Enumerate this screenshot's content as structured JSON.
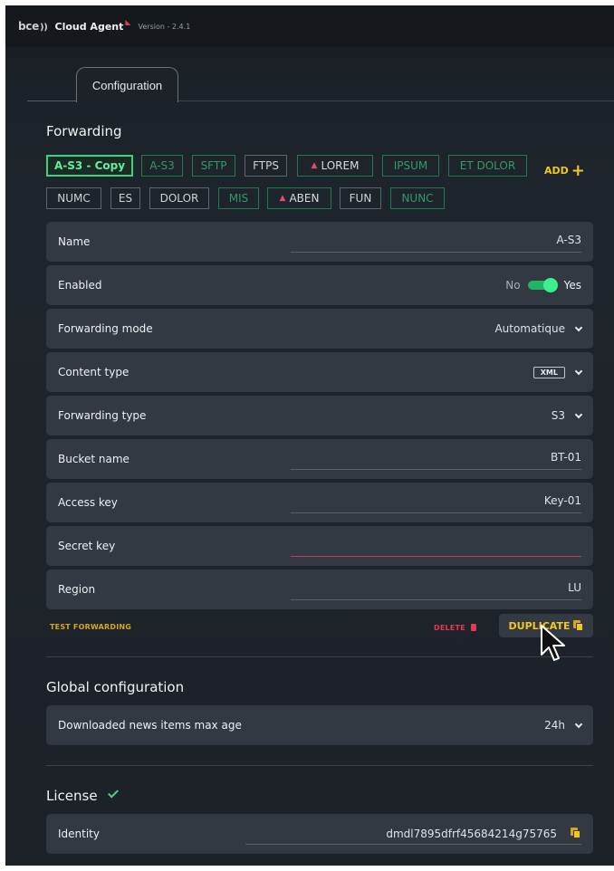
{
  "header": {
    "logo_text": "bce",
    "logo_waves": "))",
    "app_name": "Cloud Agent",
    "version": "Version - 2.4.1"
  },
  "tabs": [
    {
      "label": "Configuration",
      "active": true
    }
  ],
  "forwarding": {
    "title": "Forwarding",
    "add_label": "ADD",
    "chips_row1": [
      {
        "label": "A-S3 - Copy",
        "state": "active"
      },
      {
        "label": "A-S3",
        "state": "green"
      },
      {
        "label": "SFTP",
        "state": "green"
      },
      {
        "label": "FTPS",
        "state": "white"
      },
      {
        "label": "LOREM",
        "state": "warning"
      },
      {
        "label": "IPSUM",
        "state": "green"
      },
      {
        "label": "ET DOLOR",
        "state": "green"
      }
    ],
    "chips_row2": [
      {
        "label": "NUMC",
        "state": "white"
      },
      {
        "label": "ES",
        "state": "white"
      },
      {
        "label": "DOLOR",
        "state": "white"
      },
      {
        "label": "MIS",
        "state": "green"
      },
      {
        "label": "ABEN",
        "state": "warning"
      },
      {
        "label": "FUN",
        "state": "white"
      },
      {
        "label": "NUNC",
        "state": "green"
      }
    ],
    "fields": {
      "name": {
        "label": "Name",
        "value": "A-S3"
      },
      "enabled": {
        "label": "Enabled",
        "off_label": "No",
        "on_label": "Yes",
        "value": true
      },
      "mode": {
        "label": "Forwarding mode",
        "value": "Automatique"
      },
      "content_type": {
        "label": "Content type",
        "value": "XML"
      },
      "fwd_type": {
        "label": "Forwarding type",
        "value": "S3"
      },
      "bucket": {
        "label": "Bucket name",
        "value": "BT-01"
      },
      "access_key": {
        "label": "Access key",
        "value": "Key-01"
      },
      "secret_key": {
        "label": "Secret key",
        "value": ""
      },
      "region": {
        "label": "Region",
        "value": "LU"
      }
    },
    "actions": {
      "test": "TEST FORWARDING",
      "delete": "DELETE",
      "duplicate": "DUPLICATE"
    }
  },
  "global": {
    "title": "Global configuration",
    "max_age": {
      "label": "Downloaded news items max age",
      "value": "24h"
    }
  },
  "license": {
    "title": "License",
    "identity": {
      "label": "Identity",
      "value": "dmdl7895dfrf45684214g75765"
    }
  },
  "colors": {
    "accent_yellow": "#f2c81e",
    "accent_green": "#36d67f",
    "danger_red": "#e0395a",
    "row_bg": "#333943"
  },
  "icons": [
    "signal-icon",
    "plus-icon",
    "warning-icon",
    "chevron-down-icon",
    "trash-icon",
    "copy-icon",
    "check-icon",
    "cursor-icon"
  ]
}
